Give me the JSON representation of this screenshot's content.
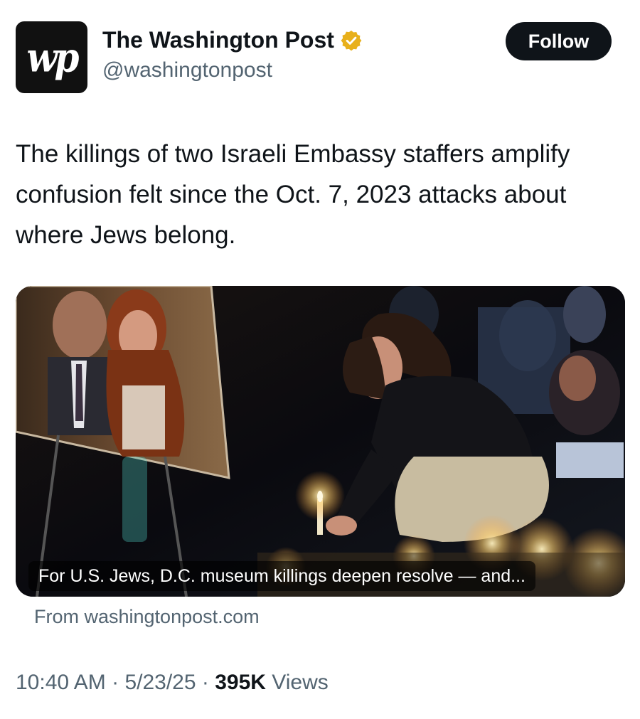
{
  "account": {
    "avatar_text": "wp",
    "display_name": "The Washington Post",
    "handle": "@washingtonpost",
    "verified_color": "#e8b01b"
  },
  "follow_button": {
    "label": "Follow"
  },
  "tweet": {
    "text": "The killings of two Israeli Embassy staffers amplify confusion felt since the Oct. 7, 2023 attacks about where Jews belong."
  },
  "link_card": {
    "caption": "For U.S. Jews, D.C. museum killings deepen resolve — and...",
    "source": "From washingtonpost.com"
  },
  "meta": {
    "time": "10:40 AM",
    "separator": " · ",
    "date": "5/23/25",
    "views_count": "395K",
    "views_label": " Views"
  }
}
